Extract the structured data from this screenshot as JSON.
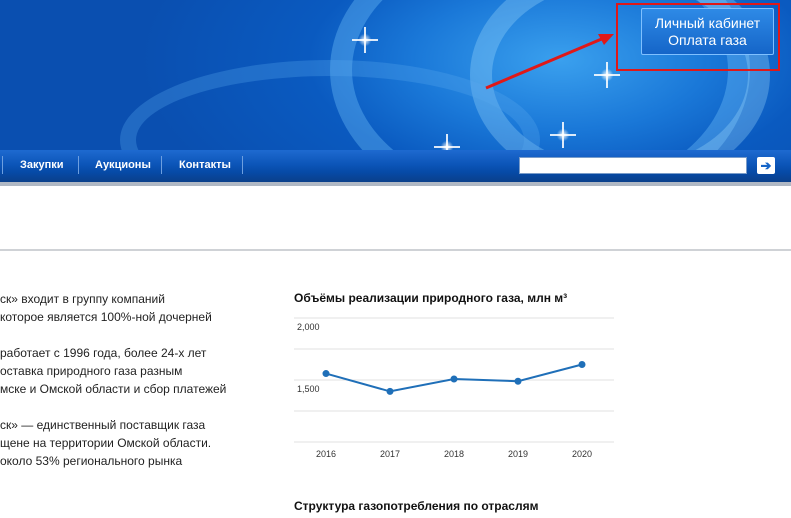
{
  "banner": {
    "cabinet_line1": "Личный кабинет",
    "cabinet_line2": "Оплата газа"
  },
  "nav": {
    "items": [
      "Закупки",
      "Аукционы",
      "Контакты"
    ],
    "search_value": "",
    "search_go": "➔"
  },
  "intro": {
    "lines": [
      [
        "ск» входит в группу компаний",
        "которое является 100%-ной дочерней"
      ],
      [
        "работает с 1996 года, более 24-х лет",
        "оставка природного газа разным",
        "мске и Омской области и сбор платежей"
      ],
      [
        "ск» — единственный поставщик газа",
        "щене на территории Омской области.",
        "около 53% регионального рынка"
      ]
    ]
  },
  "chart1": {
    "title": "Объёмы реализации природного газа, млн м³"
  },
  "chart2": {
    "title": "Структура газопотребления по отраслям"
  },
  "chart_data": {
    "type": "line",
    "title": "Объёмы реализации природного газа, млн м³",
    "x": [
      "2016",
      "2017",
      "2018",
      "2019",
      "2020"
    ],
    "series": [
      {
        "values": [
          1552,
          1408,
          1508,
          1490,
          1625
        ]
      }
    ],
    "yticks": [
      1500,
      2000
    ],
    "ytick_labels": [
      "1,500",
      "2,000"
    ],
    "ylim": [
      1000,
      2000
    ],
    "color": "#1f6fb8"
  },
  "colors": {
    "nav_bg": "#0c55b8",
    "highlight": "#e01818",
    "line": "#1f6fb8"
  }
}
